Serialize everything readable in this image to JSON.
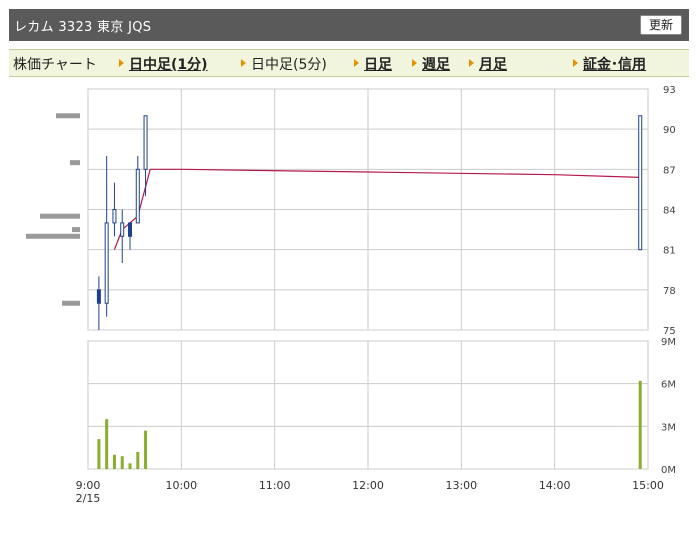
{
  "header": {
    "title": "レカム  3323  東京 JQS",
    "refresh_label": "更新"
  },
  "tabs": [
    {
      "label": "株価チャート",
      "style": "plain-noarrow"
    },
    {
      "label": "日中足(1分)",
      "style": "bold"
    },
    {
      "label": "日中足(5分)",
      "style": "plain"
    },
    {
      "label": "日足",
      "style": "bold"
    },
    {
      "label": "週足",
      "style": "bold"
    },
    {
      "label": "月足",
      "style": "bold"
    },
    {
      "label": "証金･信用",
      "style": "bold"
    }
  ],
  "colors": {
    "candle": "#1f3f8f",
    "ma_line": "#b5184b",
    "volume": "#8aad30",
    "vol_profile": "#9a9a9a",
    "grid": "#cccccc"
  },
  "chart_data": [
    {
      "type": "candlestick",
      "title": "",
      "y_ticks": [
        "93",
        "90",
        "87",
        "84",
        "81",
        "78",
        "75"
      ],
      "ylim": [
        75,
        93
      ],
      "x_ticks": [
        "9:00",
        "10:00",
        "11:00",
        "12:00",
        "13:00",
        "14:00",
        "15:00"
      ],
      "x_date": "2/15",
      "candles": [
        {
          "t": "9:07",
          "open": 78,
          "high": 79,
          "low": 75,
          "close": 77
        },
        {
          "t": "9:12",
          "open": 77,
          "high": 88,
          "low": 76,
          "close": 83
        },
        {
          "t": "9:17",
          "open": 83,
          "high": 86,
          "low": 82,
          "close": 84
        },
        {
          "t": "9:22",
          "open": 82,
          "high": 84,
          "low": 80,
          "close": 83
        },
        {
          "t": "9:27",
          "open": 83,
          "high": 83,
          "low": 81,
          "close": 82
        },
        {
          "t": "9:32",
          "open": 83,
          "high": 88,
          "low": 83,
          "close": 87
        },
        {
          "t": "9:37",
          "open": 87,
          "high": 91,
          "low": 85,
          "close": 91
        },
        {
          "t": "14:55",
          "open": 81,
          "high": 91,
          "low": 81,
          "close": 91
        }
      ],
      "moving_average": [
        {
          "t": "9:17",
          "v": 81
        },
        {
          "t": "9:22",
          "v": 82.5
        },
        {
          "t": "9:32",
          "v": 83.5
        },
        {
          "t": "9:40",
          "v": 87
        },
        {
          "t": "10:00",
          "v": 87
        },
        {
          "t": "12:00",
          "v": 86.8
        },
        {
          "t": "14:00",
          "v": 86.6
        },
        {
          "t": "14:55",
          "v": 86.4
        }
      ],
      "volume_profile": [
        {
          "price": 91,
          "weight": 0.6
        },
        {
          "price": 87.5,
          "weight": 0.25
        },
        {
          "price": 83.5,
          "weight": 1.0
        },
        {
          "price": 82.5,
          "weight": 0.2
        },
        {
          "price": 82,
          "weight": 1.35
        },
        {
          "price": 77,
          "weight": 0.45
        }
      ]
    },
    {
      "type": "bar",
      "title": "",
      "y_ticks": [
        "9M",
        "6M",
        "3M",
        "0M"
      ],
      "ylim": [
        0,
        9
      ],
      "unit": "M",
      "bars": [
        {
          "t": "9:07",
          "v": 2.1
        },
        {
          "t": "9:12",
          "v": 3.5
        },
        {
          "t": "9:17",
          "v": 1.0
        },
        {
          "t": "9:22",
          "v": 0.9
        },
        {
          "t": "9:27",
          "v": 0.4
        },
        {
          "t": "9:32",
          "v": 1.2
        },
        {
          "t": "9:37",
          "v": 2.7
        },
        {
          "t": "14:55",
          "v": 6.2
        }
      ]
    }
  ]
}
